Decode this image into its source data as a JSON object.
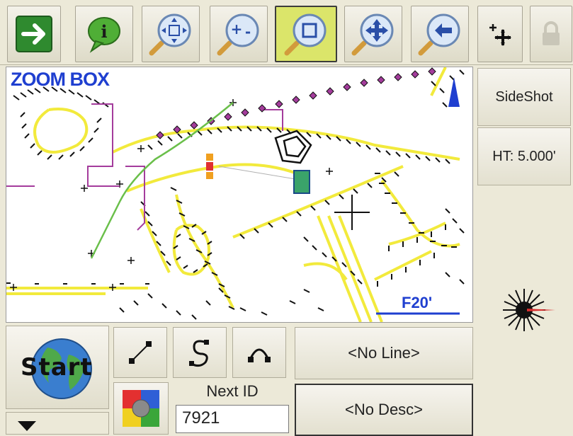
{
  "toolbar": {
    "buttons": [
      {
        "name": "exit-button",
        "icon": "green-right-arrow-icon"
      },
      {
        "name": "info-button",
        "icon": "info-bubble-icon"
      },
      {
        "name": "zoom-extents-button",
        "icon": "zoom-extents-icon"
      },
      {
        "name": "zoom-in-out-button",
        "icon": "zoom-in-out-icon"
      },
      {
        "name": "zoom-box-button",
        "icon": "zoom-box-icon",
        "active": true
      },
      {
        "name": "pan-button",
        "icon": "pan-icon"
      },
      {
        "name": "zoom-previous-button",
        "icon": "zoom-previous-icon"
      },
      {
        "name": "add-point-button",
        "icon": "add-points-icon"
      },
      {
        "name": "lock-button",
        "icon": "lock-icon"
      }
    ]
  },
  "map": {
    "mode_label": "ZOOM BOX",
    "scale_label": "F20'"
  },
  "right_panel": {
    "sideshot_label": "SideShot",
    "height_label": "HT: 5.000'"
  },
  "bottom": {
    "start_label": "Start",
    "line_label": "<No Line>",
    "desc_label": "<No Desc>",
    "next_id_label": "Next ID",
    "next_id_value": "7921"
  },
  "colors": {
    "accent_active": "#dbe56a",
    "map_text": "#1f3fd0",
    "road": "#f2ea3c",
    "boundary": "#a43c9c",
    "green_line": "#6abf4a"
  }
}
